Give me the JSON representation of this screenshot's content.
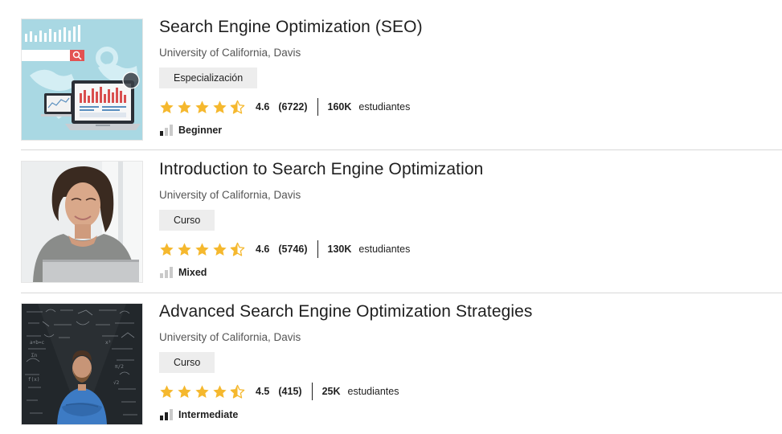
{
  "results": [
    {
      "title": "Search Engine Optimization (SEO)",
      "partner": "University of California, Davis",
      "type": "Especialización",
      "rating": "4.6",
      "rating_count": "(6722)",
      "enrollment": "160K",
      "enrollment_label": "estudiantes",
      "level": "Beginner",
      "stars_filled": 4.5,
      "level_bars_active": 1
    },
    {
      "title": "Introduction to Search Engine Optimization",
      "partner": "University of California, Davis",
      "type": "Curso",
      "rating": "4.6",
      "rating_count": "(5746)",
      "enrollment": "130K",
      "enrollment_label": "estudiantes",
      "level": "Mixed",
      "stars_filled": 4.5,
      "level_bars_active": 0
    },
    {
      "title": "Advanced Search Engine Optimization Strategies",
      "partner": "University of California, Davis",
      "type": "Curso",
      "rating": "4.5",
      "rating_count": "(415)",
      "enrollment": "25K",
      "enrollment_label": "estudiantes",
      "level": "Intermediate",
      "stars_filled": 4.5,
      "level_bars_active": 2
    }
  ],
  "colors": {
    "star": "#f5b82e",
    "divider": "#d8d8d8",
    "tag_bg": "#ededed",
    "level_active": "#1f1f1f",
    "level_inactive": "#c9c9c9"
  }
}
